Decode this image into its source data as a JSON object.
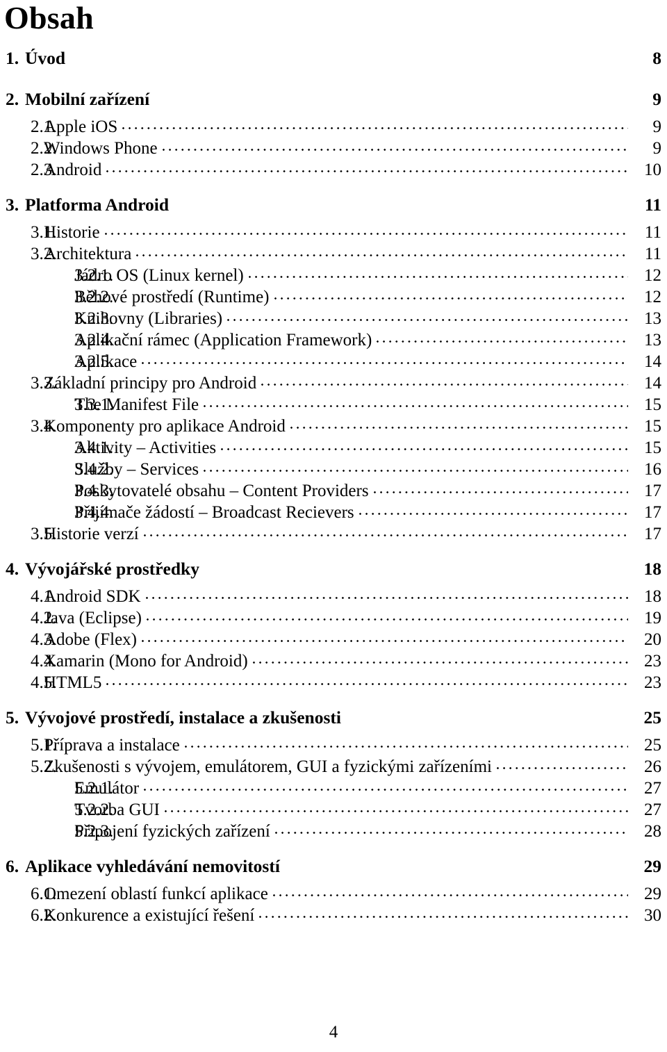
{
  "document": {
    "title": "Obsah",
    "footer_page_number": "4"
  },
  "toc": {
    "entries": [
      {
        "level": 1,
        "number": "1.",
        "label": "Úvod",
        "page": "8"
      },
      {
        "level": 1,
        "number": "2.",
        "label": "Mobilní zařízení",
        "page": "9"
      },
      {
        "level": 2,
        "number": "2.1.",
        "label": "Apple iOS",
        "page": "9"
      },
      {
        "level": 2,
        "number": "2.2.",
        "label": "Windows Phone",
        "page": "9"
      },
      {
        "level": 2,
        "number": "2.3.",
        "label": "Android",
        "page": "10"
      },
      {
        "level": 1,
        "number": "3.",
        "label": "Platforma Android",
        "page": "11"
      },
      {
        "level": 2,
        "number": "3.1.",
        "label": "Historie",
        "page": "11"
      },
      {
        "level": 2,
        "number": "3.2.",
        "label": "Architektura",
        "page": "11"
      },
      {
        "level": 3,
        "number": "3.2.1.",
        "label": "Jádro OS (Linux kernel)",
        "page": "12"
      },
      {
        "level": 3,
        "number": "3.2.2.",
        "label": "Běhové prostředí (Runtime)",
        "page": "12"
      },
      {
        "level": 3,
        "number": "3.2.3.",
        "label": "Knihovny (Libraries)",
        "page": "13"
      },
      {
        "level": 3,
        "number": "3.2.4.",
        "label": "Aplikační rámec (Application Framework)",
        "page": "13"
      },
      {
        "level": 3,
        "number": "3.2.5.",
        "label": "Aplikace",
        "page": "14"
      },
      {
        "level": 2,
        "number": "3.3.",
        "label": "Základní principy pro Android",
        "page": "14"
      },
      {
        "level": 3,
        "number": "3.3.1.",
        "label": "The Manifest File",
        "page": "15"
      },
      {
        "level": 2,
        "number": "3.4.",
        "label": "Komponenty pro aplikace Android",
        "page": "15"
      },
      {
        "level": 3,
        "number": "3.4.1.",
        "label": "Aktivity – Activities",
        "page": "15"
      },
      {
        "level": 3,
        "number": "3.4.2.",
        "label": "Služby – Services",
        "page": "16"
      },
      {
        "level": 3,
        "number": "3.4.3.",
        "label": "Poskytovatelé obsahu – Content Providers",
        "page": "17"
      },
      {
        "level": 3,
        "number": "3.4.4.",
        "label": "Přijímače žádostí – Broadcast Recievers",
        "page": "17"
      },
      {
        "level": 2,
        "number": "3.5.",
        "label": "Historie verzí",
        "page": "17"
      },
      {
        "level": 1,
        "number": "4.",
        "label": "Vývojářské prostředky",
        "page": "18"
      },
      {
        "level": 2,
        "number": "4.1.",
        "label": "Android SDK",
        "page": "18"
      },
      {
        "level": 2,
        "number": "4.2.",
        "label": "Java (Eclipse)",
        "page": "19"
      },
      {
        "level": 2,
        "number": "4.3.",
        "label": "Adobe (Flex)",
        "page": "20"
      },
      {
        "level": 2,
        "number": "4.4.",
        "label": "Xamarin (Mono for Android)",
        "page": "23"
      },
      {
        "level": 2,
        "number": "4.5.",
        "label": "HTML5",
        "page": "23"
      },
      {
        "level": 1,
        "number": "5.",
        "label": "Vývojové prostředí, instalace a zkušenosti",
        "page": "25"
      },
      {
        "level": 2,
        "number": "5.1.",
        "label": "Příprava a instalace",
        "page": "25"
      },
      {
        "level": 2,
        "number": "5.2.",
        "label": "Zkušenosti s vývojem, emulátorem, GUI a fyzickými zařízeními",
        "page": "26"
      },
      {
        "level": 3,
        "number": "5.2.1.",
        "label": "Emulátor",
        "page": "27"
      },
      {
        "level": 3,
        "number": "5.2.2.",
        "label": "Tvorba GUI",
        "page": "27"
      },
      {
        "level": 3,
        "number": "5.2.3.",
        "label": "Připojení fyzických zařízení",
        "page": "28"
      },
      {
        "level": 1,
        "number": "6.",
        "label": "Aplikace vyhledávání nemovitostí",
        "page": "29"
      },
      {
        "level": 2,
        "number": "6.1.",
        "label": "Omezení oblastí funkcí aplikace",
        "page": "29"
      },
      {
        "level": 2,
        "number": "6.2.",
        "label": "Konkurence a existující řešení",
        "page": "30"
      }
    ]
  }
}
